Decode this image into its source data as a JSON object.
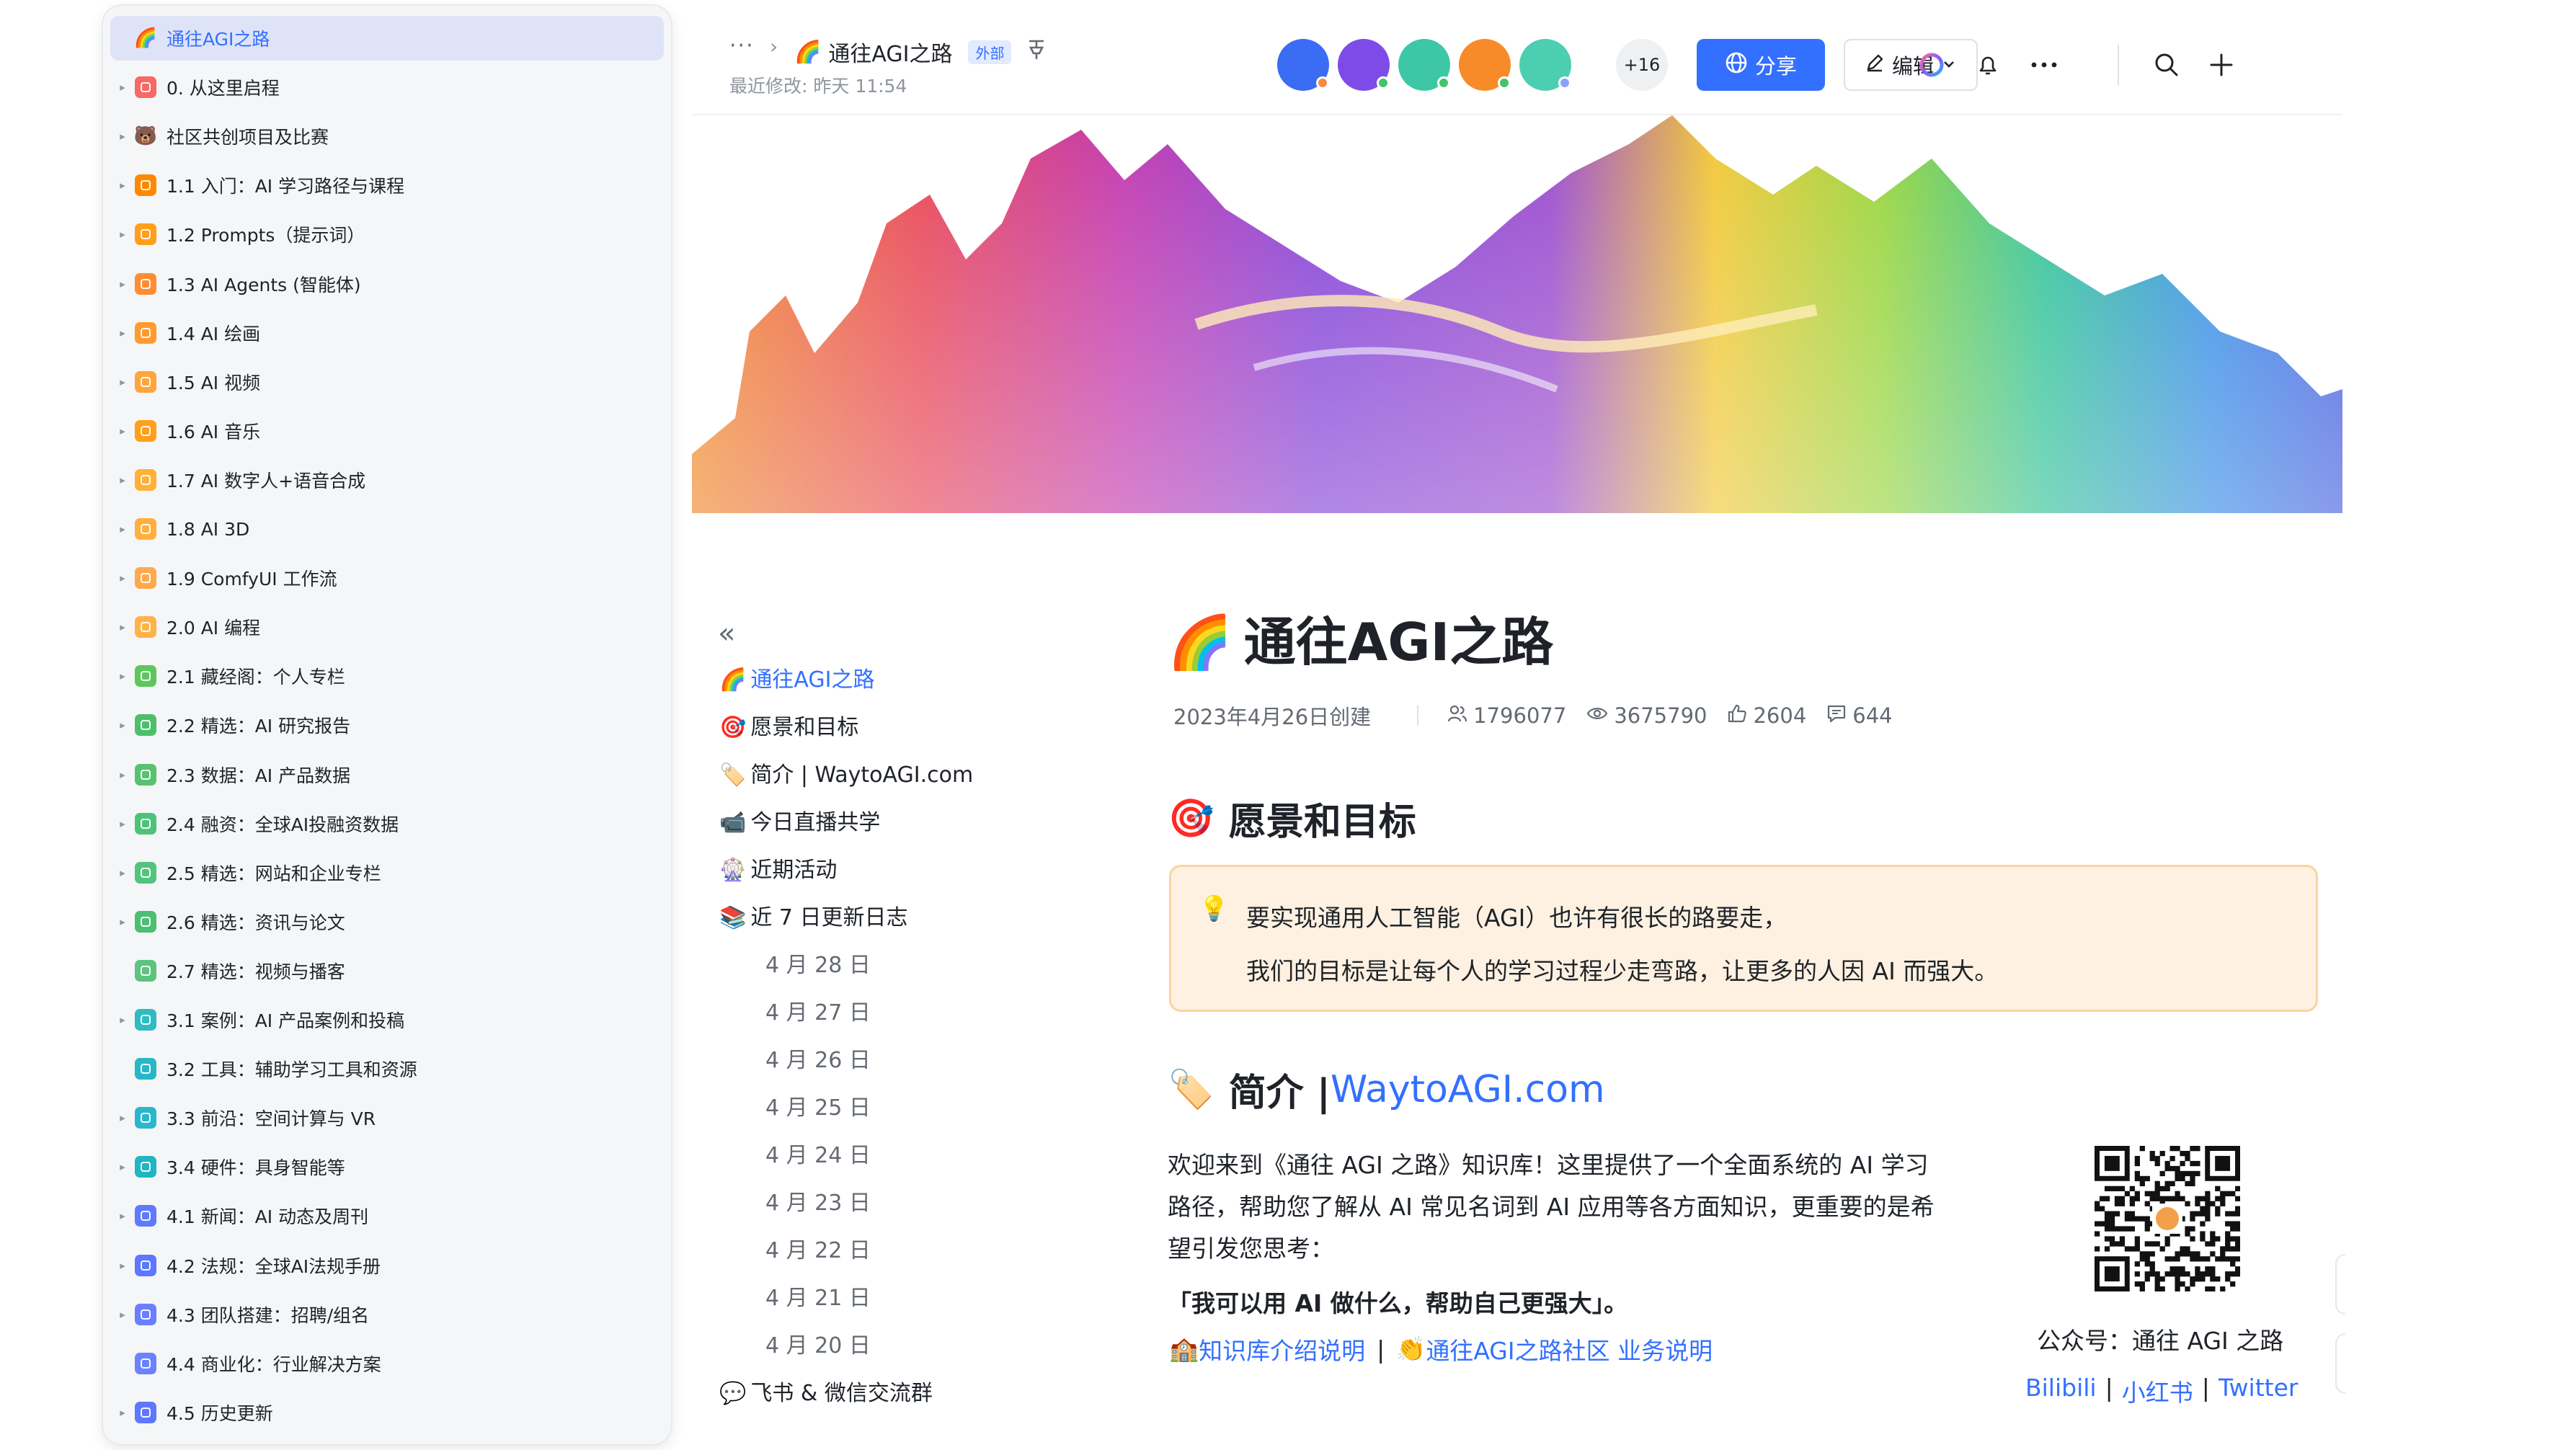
{
  "sidebar": {
    "items": [
      {
        "label": "通往AGI之路",
        "icon": "rainbow-emoji",
        "icon_glyph": "🌈",
        "active": true,
        "arrow": false,
        "color": ""
      },
      {
        "label": "0. 从这里启程",
        "icon": "doc-icon",
        "active": false,
        "arrow": true,
        "color": "#f76964"
      },
      {
        "label": "社区共创项目及比赛",
        "icon": "bear-emoji",
        "icon_glyph": "🐻",
        "active": false,
        "arrow": true,
        "color": ""
      },
      {
        "label": "1.1 入门：AI 学习路径与课程",
        "icon": "doc-icon",
        "active": false,
        "arrow": true,
        "color": "#ff8800"
      },
      {
        "label": "1.2 Prompts（提示词）",
        "icon": "doc-icon",
        "active": false,
        "arrow": true,
        "color": "#ff9f1a"
      },
      {
        "label": "1.3 AI Agents (智能体)",
        "icon": "doc-icon",
        "active": false,
        "arrow": true,
        "color": "#ff8c33"
      },
      {
        "label": "1.4 AI 绘画",
        "icon": "doc-icon",
        "active": false,
        "arrow": true,
        "color": "#ff9a2e"
      },
      {
        "label": "1.5 AI 视频",
        "icon": "doc-icon",
        "active": false,
        "arrow": true,
        "color": "#ffa53d"
      },
      {
        "label": "1.6 AI 音乐",
        "icon": "doc-icon",
        "active": false,
        "arrow": true,
        "color": "#ff9f1a"
      },
      {
        "label": "1.7 AI 数字人+语音合成",
        "icon": "doc-icon",
        "active": false,
        "arrow": true,
        "color": "#ffb037"
      },
      {
        "label": "1.8 AI 3D",
        "icon": "doc-icon",
        "active": false,
        "arrow": true,
        "color": "#ffaf40"
      },
      {
        "label": "1.9 ComfyUI 工作流",
        "icon": "doc-icon",
        "active": false,
        "arrow": true,
        "color": "#ffa94d"
      },
      {
        "label": "2.0 AI 编程",
        "icon": "doc-icon",
        "active": false,
        "arrow": true,
        "color": "#ffb347"
      },
      {
        "label": "2.1 藏经阁：个人专栏",
        "icon": "doc-icon",
        "active": false,
        "arrow": true,
        "color": "#5cc85c"
      },
      {
        "label": "2.2 精选：AI 研究报告",
        "icon": "doc-icon",
        "active": false,
        "arrow": true,
        "color": "#4cbf6b"
      },
      {
        "label": "2.3 数据：AI 产品数据",
        "icon": "doc-icon",
        "active": false,
        "arrow": true,
        "color": "#57c26f"
      },
      {
        "label": "2.4 融资：全球AI投融资数据",
        "icon": "doc-icon",
        "active": false,
        "arrow": true,
        "color": "#4fc27a"
      },
      {
        "label": "2.5 精选：网站和企业专栏",
        "icon": "doc-icon",
        "active": false,
        "arrow": true,
        "color": "#52c47e"
      },
      {
        "label": "2.6 精选：资讯与论文",
        "icon": "doc-icon",
        "active": false,
        "arrow": true,
        "color": "#4bbf73"
      },
      {
        "label": "2.7 精选：视频与播客",
        "icon": "doc-icon",
        "active": false,
        "arrow": false,
        "color": "#5bc47f"
      },
      {
        "label": "3.1 案例：AI 产品案例和投稿",
        "icon": "doc-icon",
        "active": false,
        "arrow": true,
        "color": "#2ebbc4"
      },
      {
        "label": "3.2 工具：辅助学习工具和资源",
        "icon": "doc-icon",
        "active": false,
        "arrow": false,
        "color": "#26b8c9"
      },
      {
        "label": "3.3 前沿：空间计算与 VR",
        "icon": "doc-icon",
        "active": false,
        "arrow": true,
        "color": "#2ab7cc"
      },
      {
        "label": "3.4 硬件：具身智能等",
        "icon": "doc-icon",
        "active": false,
        "arrow": true,
        "color": "#22b5c2"
      },
      {
        "label": "4.1 新闻：AI 动态及周刊",
        "icon": "doc-icon",
        "active": false,
        "arrow": true,
        "color": "#5e7bff"
      },
      {
        "label": "4.2 法规：全球AI法规手册",
        "icon": "doc-icon",
        "active": false,
        "arrow": true,
        "color": "#5b78ff"
      },
      {
        "label": "4.3 团队搭建：招聘/组名",
        "icon": "doc-icon",
        "active": false,
        "arrow": true,
        "color": "#6a7fff"
      },
      {
        "label": "4.4 商业化：行业解决方案",
        "icon": "doc-icon",
        "active": false,
        "arrow": false,
        "color": "#6b82ff"
      },
      {
        "label": "4.5 历史更新",
        "icon": "doc-icon",
        "active": false,
        "arrow": true,
        "color": "#6077ff"
      }
    ]
  },
  "topbar": {
    "breadcrumb_more": "···",
    "breadcrumb_sep": "›",
    "doc_emoji": "🌈",
    "doc_title": "通往AGI之路",
    "external_badge": "外部",
    "last_modified": "最近修改: 昨天 11:54",
    "avatars": [
      {
        "bg": "#3a6cf4",
        "status": "#f58a42"
      },
      {
        "bg": "#7f4be8",
        "status": "#45c26b"
      },
      {
        "bg": "#3ec7a7",
        "status": "#45c26b"
      },
      {
        "bg": "#f78b2a",
        "status": "#45c26b"
      },
      {
        "bg": "#4ccfb0",
        "status": "#8aa2ff"
      }
    ],
    "avatars_more": "+16",
    "share_label": "分享",
    "edit_label": "编辑",
    "brand_color": "#3370ff"
  },
  "toc": {
    "collapse_icon": "«",
    "items": [
      {
        "emoji": "🌈",
        "label": "通往AGI之路",
        "active": true,
        "date": false
      },
      {
        "emoji": "🎯",
        "label": "愿景和目标",
        "active": false,
        "date": false
      },
      {
        "emoji": "🏷️",
        "label": "简介 | WaytoAGI.com",
        "active": false,
        "date": false
      },
      {
        "emoji": "📹",
        "label": "今日直播共学",
        "active": false,
        "date": false
      },
      {
        "emoji": "🎡",
        "label": "近期活动",
        "active": false,
        "date": false
      },
      {
        "emoji": "📚",
        "label": "近 7 日更新日志",
        "active": false,
        "date": false
      },
      {
        "emoji": "",
        "label": "4 月 28 日",
        "active": false,
        "date": true
      },
      {
        "emoji": "",
        "label": "4 月 27 日",
        "active": false,
        "date": true
      },
      {
        "emoji": "",
        "label": "4 月 26 日",
        "active": false,
        "date": true
      },
      {
        "emoji": "",
        "label": "4 月 25 日",
        "active": false,
        "date": true
      },
      {
        "emoji": "",
        "label": "4 月 24 日",
        "active": false,
        "date": true
      },
      {
        "emoji": "",
        "label": "4 月 23 日",
        "active": false,
        "date": true
      },
      {
        "emoji": "",
        "label": "4 月 22 日",
        "active": false,
        "date": true
      },
      {
        "emoji": "",
        "label": "4 月 21 日",
        "active": false,
        "date": true
      },
      {
        "emoji": "",
        "label": "4 月 20 日",
        "active": false,
        "date": true
      },
      {
        "emoji": "💬",
        "label": "飞书 & 微信交流群",
        "active": false,
        "date": false
      }
    ]
  },
  "doc": {
    "emoji": "🌈",
    "title": "通往AGI之路",
    "created": "2023年4月26日创建",
    "stats": {
      "members": "1796077",
      "views": "3675790",
      "likes": "2604",
      "comments": "644"
    },
    "section_vision": {
      "emoji": "🎯",
      "title": "愿景和目标"
    },
    "callout": {
      "line1": "要实现通用人工智能（AGI）也许有很长的路要走，",
      "line2": "我们的目标是让每个人的学习过程少走弯路，让更多的人因 AI 而强大。"
    },
    "section_intro": {
      "emoji": "🏷️",
      "title": "简介 | ",
      "link": "WaytoAGI.com"
    },
    "intro_lines": [
      "欢迎来到《通往 AGI 之路》知识库！这里提供了一个全面系统的 AI 学习",
      "路径，帮助您了解从 AI 常见名词到 AI 应用等各方面知识，更重要的是希",
      "望引发您思考："
    ],
    "intro_bold": "「我可以用 AI 做什么，帮助自己更强大」。",
    "links": {
      "kb_emoji": "🏫",
      "kb_label": "知识库介绍说明",
      "community_emoji": "👏",
      "community_label": "通往AGI之路社区 业务说明"
    },
    "qr_caption": "公众号：通往 AGI 之路",
    "social": [
      "Bilibili",
      "小红书",
      "Twitter"
    ]
  }
}
